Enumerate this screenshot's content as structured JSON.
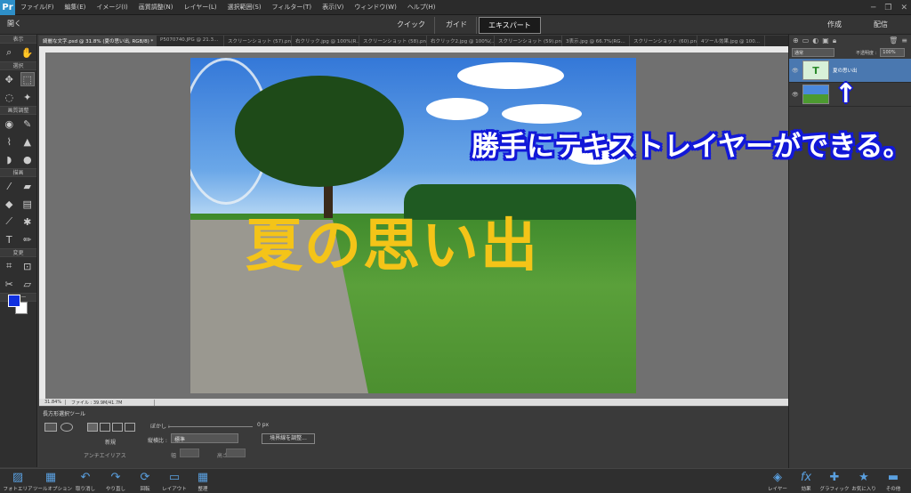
{
  "menubar": {
    "app_icon": "Pr",
    "items": [
      "ファイル(F)",
      "編集(E)",
      "イメージ(I)",
      "画質調整(N)",
      "レイヤー(L)",
      "選択範囲(S)",
      "フィルター(T)",
      "表示(V)",
      "ウィンドウ(W)",
      "ヘルプ(H)"
    ]
  },
  "modebar": {
    "open": "開く",
    "tabs": [
      "クイック",
      "ガイド",
      "エキスパート"
    ],
    "active_tab": "エキスパート",
    "create": "作成",
    "share": "配信"
  },
  "toolbox": {
    "sections": [
      "表示",
      "選択",
      "画質調整",
      "描画",
      "変更",
      "カラー"
    ]
  },
  "doc_tabs": [
    "綺麗な文字.psd @ 31.8% (夏の思い出, RGB/8) *",
    "P5070740.JPG @ 21.3...",
    "スクリーンショット (57).png",
    "右クリック.jpg @ 100%(R...",
    "スクリーンショット (58).png",
    "右クリック2.jpg @ 100%(...",
    "スクリーンショット (59).png",
    "3表示.jpg @ 66.7%(RG...",
    "スクリーンショット (60).png",
    "4ツール効果.jpg @ 100..."
  ],
  "canvas": {
    "overlay_text": "夏の思い出"
  },
  "statusbar": {
    "zoom": "31.84%",
    "file_info": "ファイル : 39.9M/41.7M"
  },
  "options": {
    "title": "長方形選択ツール",
    "new_label": "新規",
    "anti_alias": "アンチエイリアス",
    "feather_label": "ぼかし :",
    "feather_value": "0 px",
    "aspect_label": "縦横比 :",
    "aspect_value": "標準",
    "w_label": "幅",
    "h_label": "高さ",
    "refine_button": "境界線を調整..."
  },
  "bottombar_left": [
    {
      "icon": "photo-bin-icon",
      "label": "フォトエリア"
    },
    {
      "icon": "tool-options-icon",
      "label": "ツールオプション"
    },
    {
      "icon": "undo-icon",
      "label": "取り消し"
    },
    {
      "icon": "redo-icon",
      "label": "やり直し"
    },
    {
      "icon": "rotate-icon",
      "label": "回転"
    },
    {
      "icon": "layout-icon",
      "label": "レイアウト"
    },
    {
      "icon": "organize-icon",
      "label": "整理"
    }
  ],
  "bottombar_right": [
    {
      "icon": "layers-icon",
      "label": "レイヤー"
    },
    {
      "icon": "effects-icon",
      "label": "効果"
    },
    {
      "icon": "graphics-icon",
      "label": "グラフィック"
    },
    {
      "icon": "favorites-icon",
      "label": "お気に入り"
    },
    {
      "icon": "more-icon",
      "label": "その他"
    }
  ],
  "layers_panel": {
    "blend_mode": "通常",
    "opacity_label": "不透明度 :",
    "opacity_value": "100%",
    "layers": [
      {
        "name": "夏の思い出",
        "type": "text",
        "thumb": "T"
      },
      {
        "name": "",
        "type": "image",
        "thumb": ""
      }
    ]
  },
  "annotation": {
    "text": "勝手にテキストレイヤーができる。",
    "arrow": "↑"
  },
  "colors": {
    "foreground": "#1030e0",
    "background": "#ffffff",
    "title_text": "#f4c418",
    "annotation_outline": "#1218d8",
    "selected_layer": "#4a78b0"
  }
}
